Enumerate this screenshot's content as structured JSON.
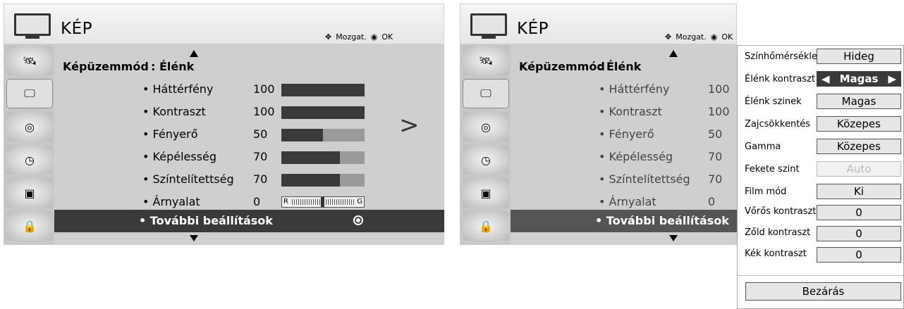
{
  "left": {
    "title": "KÉP",
    "nav_hint": "Mozgat.",
    "ok_label": "OK",
    "mode_label": "Képüzemmód",
    "mode_value": ": Élénk",
    "settings": [
      {
        "label": "• Háttérfény",
        "value": "100",
        "level": 1.0
      },
      {
        "label": "• Kontraszt",
        "value": "100",
        "level": 1.0
      },
      {
        "label": "• Fényerő",
        "value": "50",
        "level": 0.5
      },
      {
        "label": "• Képélesség",
        "value": "70",
        "level": 0.7
      },
      {
        "label": "• Színtelítettség",
        "value": "70",
        "level": 0.7
      },
      {
        "label": "• Árnyalat",
        "value": "0",
        "tint_left": "R",
        "tint_right": "G"
      }
    ],
    "more_label": "• További beállítások"
  },
  "right": {
    "title": "KÉP",
    "nav_hint": "Mozgat.",
    "ok_label": "OK",
    "mode_label": "Képüzemmód",
    "mode_value": ": Élénk",
    "settings": [
      {
        "label": "• Háttérfény",
        "value": "100"
      },
      {
        "label": "• Kontraszt",
        "value": "100"
      },
      {
        "label": "• Fényerő",
        "value": "50"
      },
      {
        "label": "• Képélesség",
        "value": "70"
      },
      {
        "label": "• Színtelítettség",
        "value": "70"
      },
      {
        "label": "• Árnyalat",
        "value": "0"
      }
    ],
    "more_label": "• További beállítások"
  },
  "transition_arrow": ">",
  "popup": {
    "options": [
      {
        "label": "Színhőmérséklet",
        "value": "Hideg"
      },
      {
        "label": "Élénk kontraszt",
        "value": "Magas",
        "selected": true
      },
      {
        "label": "Élénk szinek",
        "value": "Magas"
      },
      {
        "label": "Zajcsökkentés",
        "value": "Közepes"
      },
      {
        "label": "Gamma",
        "value": "Közepes"
      },
      {
        "label": "Fekete szint",
        "value": "Auto",
        "disabled": true
      },
      {
        "label": "Film mód",
        "value": "Ki"
      },
      {
        "label": "Vőrős kontraszt",
        "value": "0"
      },
      {
        "label": "Zőld kontraszt",
        "value": "0"
      },
      {
        "label": "Kék kontraszt",
        "value": "0"
      }
    ],
    "close_label": "Bezárás"
  },
  "colors": {
    "bar_fill": "#3a3a3a",
    "bar_track": "#9a9a9a",
    "highlight": "#3a3a3a",
    "menu_bg": "#c8c8c8"
  }
}
